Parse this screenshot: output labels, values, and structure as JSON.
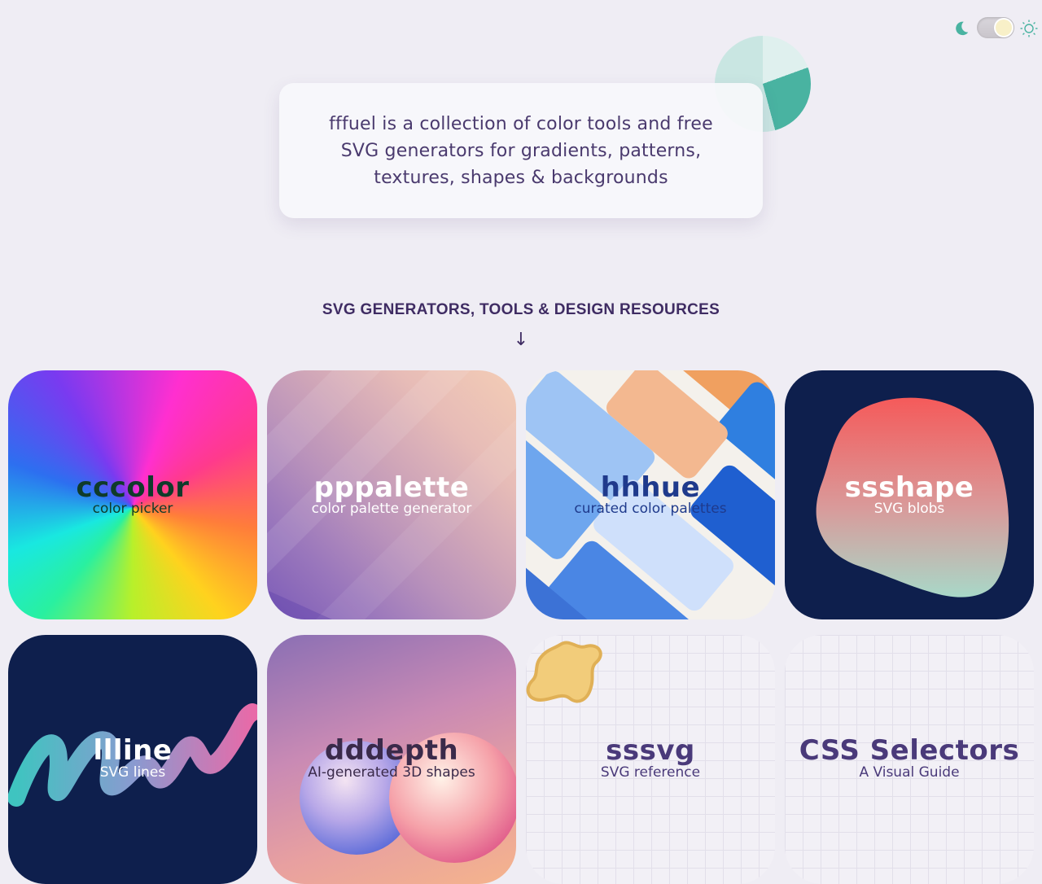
{
  "header": {
    "intro": "fffuel is a collection of color tools and free SVG generators for gradients, patterns, textures, shapes & backgrounds"
  },
  "theme": {
    "dark_icon": "moon-icon",
    "light_icon": "sun-icon",
    "mode": "light"
  },
  "section": {
    "title": "SVG GENERATORS, TOOLS & DESIGN RESOURCES",
    "arrow": "↓"
  },
  "tools": [
    {
      "name": "cccolor",
      "desc": "color picker"
    },
    {
      "name": "pppalette",
      "desc": "color palette generator"
    },
    {
      "name": "hhhue",
      "desc": "curated color palettes"
    },
    {
      "name": "ssshape",
      "desc": "SVG blobs"
    },
    {
      "name": "llline",
      "desc": "SVG lines"
    },
    {
      "name": "dddepth",
      "desc": "AI-generated 3D shapes"
    },
    {
      "name": "sssvg",
      "desc": "SVG reference"
    },
    {
      "name": "CSS Selectors",
      "desc": "A Visual Guide"
    }
  ],
  "colors": {
    "accent": "#49b3a1",
    "text": "#4a3a6e",
    "background": "#efedf4"
  }
}
